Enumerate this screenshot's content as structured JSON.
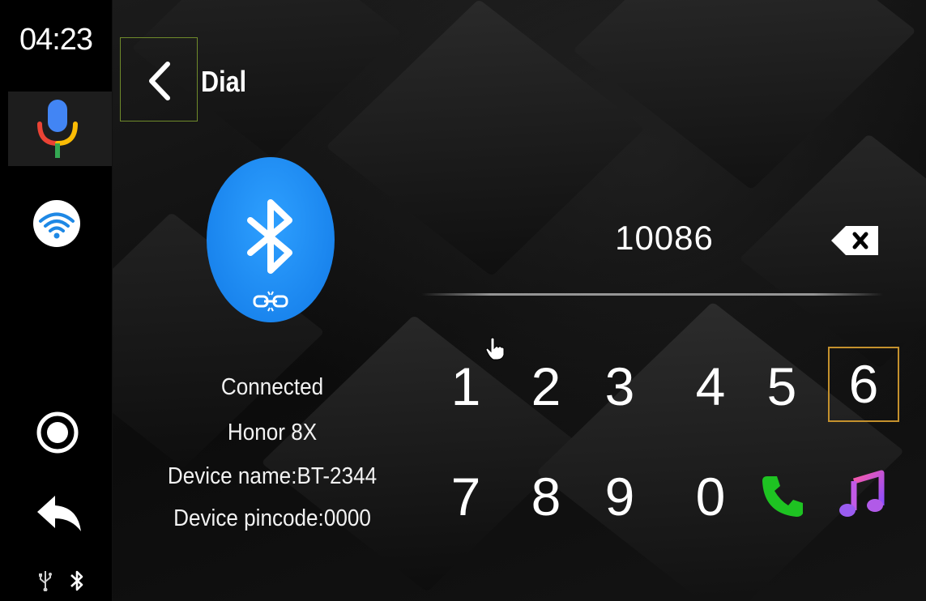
{
  "status": {
    "time": "04:23"
  },
  "header": {
    "title": "Dial"
  },
  "device": {
    "status": "Connected",
    "model": "Honor 8X",
    "device_name": "Device name:BT-2344",
    "pincode": "Device pincode:0000"
  },
  "dialer": {
    "number": "10086",
    "row1": [
      "1",
      "2",
      "3",
      "4",
      "5",
      "6"
    ],
    "row2": [
      "7",
      "8",
      "9",
      "0"
    ],
    "selected_key": "6"
  },
  "icons": {
    "mic": "microphone-icon",
    "wifi": "wifi-icon",
    "home": "home-circle-icon",
    "back": "back-arrow-icon",
    "usb": "usb-icon",
    "bluetooth": "bluetooth-icon",
    "call": "phone-call-icon",
    "music": "music-note-icon",
    "backspace": "backspace-icon"
  },
  "colors": {
    "accent_blue": "#1a85ee",
    "call_green": "#1ec322",
    "selection_border": "#c4912d",
    "back_border": "#6f8a2b"
  }
}
